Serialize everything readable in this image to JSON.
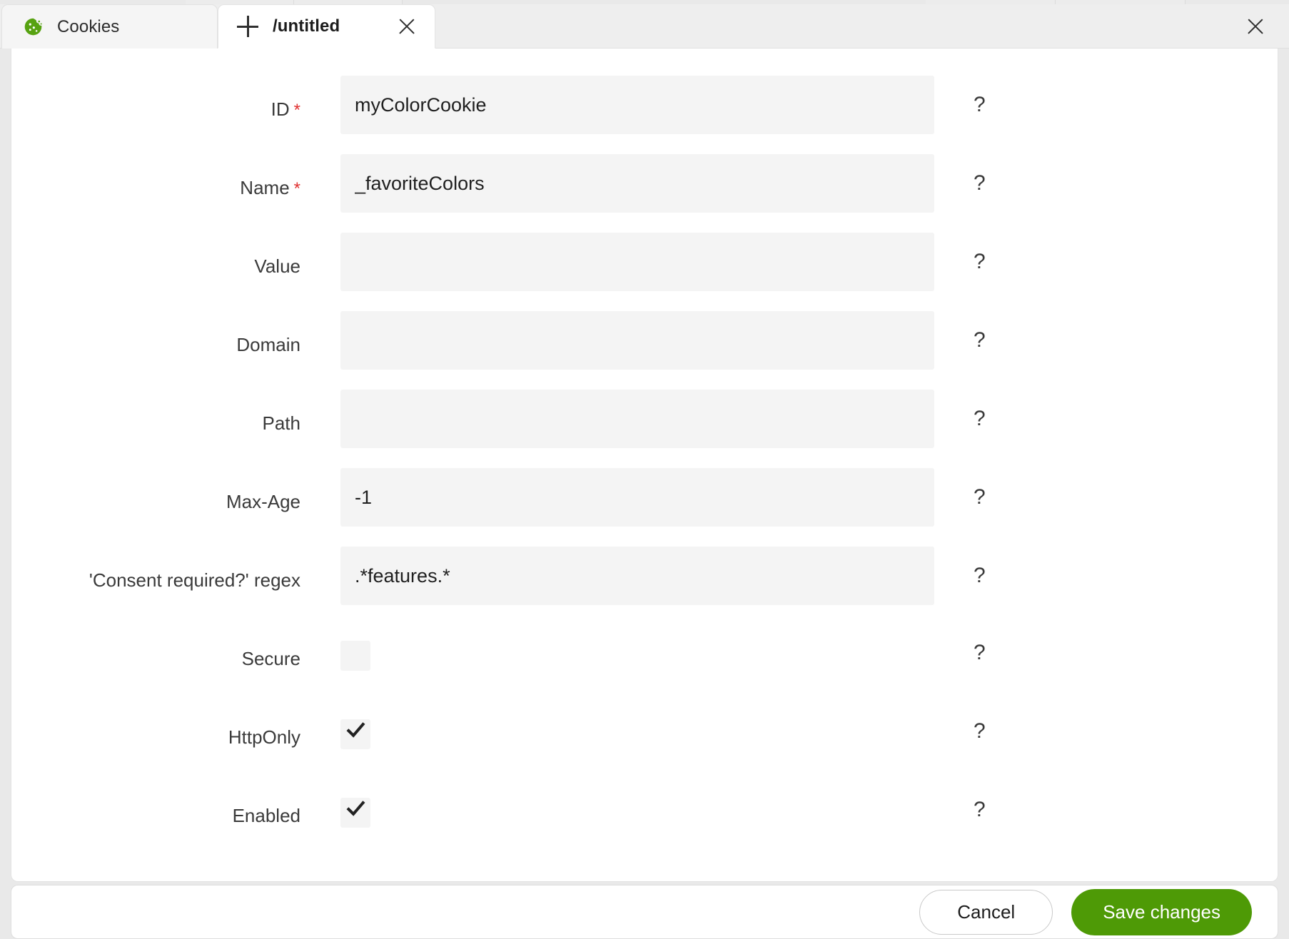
{
  "window": {
    "close_icon": "close-icon"
  },
  "tabs": [
    {
      "label": "Cookies",
      "icon": "cookie-icon",
      "active": false,
      "closable": false
    },
    {
      "label": "/untitled",
      "icon": "plus-icon",
      "active": true,
      "closable": true
    }
  ],
  "form": {
    "help_glyph": "?",
    "fields": [
      {
        "label": "ID",
        "required": true,
        "type": "text",
        "value": "myColorCookie",
        "placeholder": ""
      },
      {
        "label": "Name",
        "required": true,
        "type": "text",
        "value": "_favoriteColors",
        "placeholder": ""
      },
      {
        "label": "Value",
        "required": false,
        "type": "text",
        "value": "",
        "placeholder": ""
      },
      {
        "label": "Domain",
        "required": false,
        "type": "text",
        "value": "",
        "placeholder": ""
      },
      {
        "label": "Path",
        "required": false,
        "type": "text",
        "value": "",
        "placeholder": ""
      },
      {
        "label": "Max-Age",
        "required": false,
        "type": "text",
        "value": "-1",
        "placeholder": ""
      },
      {
        "label": "'Consent required?' regex",
        "required": false,
        "type": "text",
        "value": ".*features.*",
        "placeholder": ""
      },
      {
        "label": "Secure",
        "required": false,
        "type": "checkbox",
        "checked": false
      },
      {
        "label": "HttpOnly",
        "required": false,
        "type": "checkbox",
        "checked": true
      },
      {
        "label": "Enabled",
        "required": false,
        "type": "checkbox",
        "checked": true
      }
    ]
  },
  "footer": {
    "cancel_label": "Cancel",
    "save_label": "Save changes"
  },
  "colors": {
    "save_button": "#4e9a06",
    "required_star": "#e03030",
    "cookie": "#57a211",
    "input_bg": "#f4f4f4"
  }
}
